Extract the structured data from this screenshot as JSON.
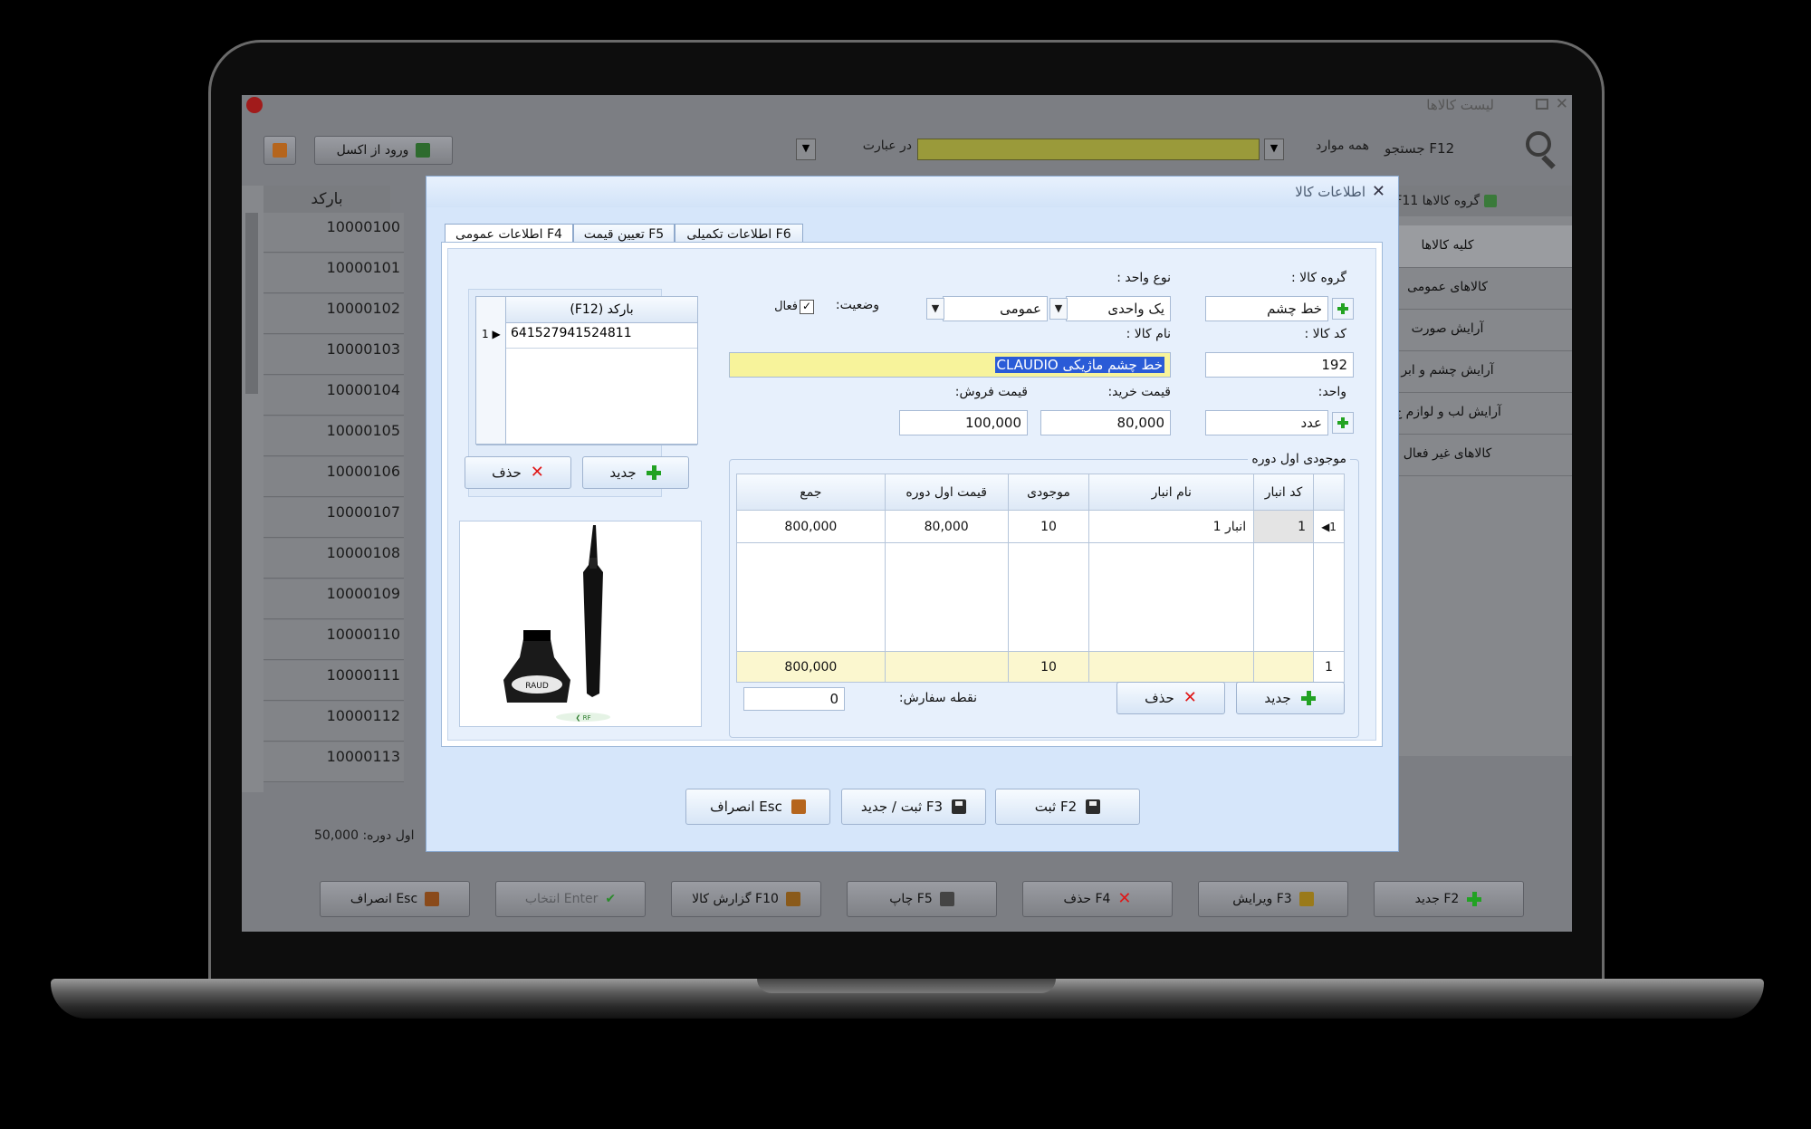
{
  "background_window": {
    "title": "لیست کالاها",
    "toolbar": {
      "import_excel_label": "ورود از اکسل",
      "search_label": "جستجو F12",
      "search_scope": "همه موارد",
      "search_mode": "در عبارت",
      "group_label": "گروه کالاها F11"
    },
    "barcode_column_header": "بارکد",
    "barcodes": [
      "10000100",
      "10000101",
      "10000102",
      "10000103",
      "10000104",
      "10000105",
      "10000106",
      "10000107",
      "10000108",
      "10000109",
      "10000110",
      "10000111",
      "10000112",
      "10000113"
    ],
    "categories": [
      "کلیه کالاها",
      "کالاهای عمومی",
      "آرایش صورت",
      "آرایش چشم و ابر",
      "آرایش لب و لوازم ج",
      "کالاهای غیر فعال"
    ],
    "footer_total": "اول دوره: 50,000",
    "bottom_buttons": {
      "new": "جدید F2",
      "edit": "ویرایش F3",
      "delete": "حذف F4",
      "print": "چاپ F5",
      "report": "گزارش کالا F10",
      "select": "انتخاب Enter",
      "cancel": "انصراف Esc"
    }
  },
  "dialog": {
    "title": "اطلاعات کالا",
    "tabs": [
      "اطلاعات عمومی F4",
      "تعیین قیمت F5",
      "اطلاعات تکمیلی F6"
    ],
    "group_label": "گروه کالا :",
    "group_value": "خط چشم",
    "unit_type_label": "نوع واحد :",
    "unit_type_value": "یک واحدی",
    "unit_type_value2": "عمومی",
    "status_label": "وضعیت:",
    "status_checkbox_label": "فعال",
    "code_label": "کد کالا :",
    "code_value": "192",
    "name_label": "نام کالا :",
    "name_value": "CLAUDIO خط چشم ماژیکی",
    "unit_label": "واحد:",
    "unit_value": "عدد",
    "purchase_price_label": "قیمت خرید:",
    "purchase_price_value": "80,000",
    "sale_price_label": "قیمت فروش:",
    "sale_price_value": "100,000",
    "barcode_header": "(F12) بارکد",
    "barcode_row_num": "1",
    "barcode_value": "641527941524811",
    "barcode_new": "جدید",
    "barcode_delete": "حذف",
    "stock_group_title": "موجودی اول دوره",
    "stock_headers": [
      "کد انبار",
      "نام انبار",
      "موجودی",
      "قیمت اول دوره",
      "جمع"
    ],
    "stock_row": {
      "num": "1",
      "code": "1",
      "name": "انبار 1",
      "qty": "10",
      "price": "80,000",
      "total": "800,000"
    },
    "stock_footer": {
      "num": "1",
      "qty": "10",
      "total": "800,000"
    },
    "stock_new": "جدید",
    "stock_delete": "حذف",
    "reorder_label": "نقطه سفارش:",
    "reorder_value": "0",
    "save_label": "ثبت F2",
    "save_new_label": "ثبت / جدید F3",
    "cancel_label": "انصراف Esc"
  }
}
